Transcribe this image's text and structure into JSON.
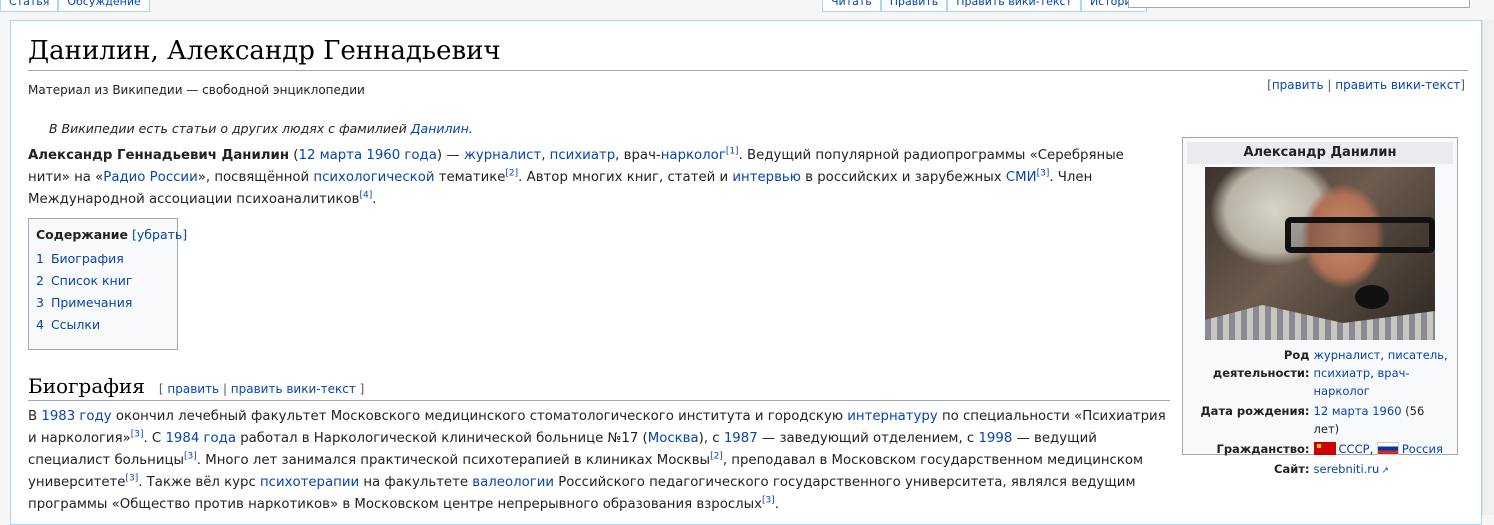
{
  "tabs": {
    "left": [
      "Статья",
      "Обсуждение"
    ],
    "right": [
      "Читать",
      "Править",
      "Править вики-текст",
      "История"
    ]
  },
  "article": {
    "title": "Данилин, Александр Геннадьевич",
    "site_sub": "Материал из Википедии — свободной энциклопедии",
    "edit_link": "править",
    "edit_source_link": "править вики-текст",
    "separator": "|",
    "hatnote_text": "В Википедии есть статьи о других людях с фамилией",
    "hatnote_link": "Данилин",
    "hatnote_end": "."
  },
  "lead": {
    "name": "Александр Геннадьевич Данилин",
    "birth_date": "12 марта 1960 года",
    "dash": " — ",
    "journalist": "журналист",
    "psychiatrist": "психиатр",
    "narco_prefix": "врач-",
    "narcologist": "нарколог",
    "ref1": "[1]",
    "t1": ". Ведущий популярной радиопрограммы «Серебряные нити» на «",
    "radio": "Радио России",
    "t2": "», посвящённой ",
    "psychological": "психологической",
    "t3": " тематике",
    "ref2": "[2]",
    "t4": ". Автор многих книг, статей и ",
    "interviews": "интервью",
    "t5": " в российских и зарубежных ",
    "media": "СМИ",
    "ref3": "[3]",
    "t6": ". Член Международной ассоциации психоаналитиков",
    "ref4": "[4]",
    "t7": "."
  },
  "toc": {
    "title": "Содержание",
    "toggle": "[убрать]",
    "items": [
      {
        "num": "1",
        "label": "Биография"
      },
      {
        "num": "2",
        "label": "Список книг"
      },
      {
        "num": "3",
        "label": "Примечания"
      },
      {
        "num": "4",
        "label": "Ссылки"
      }
    ]
  },
  "bio_section": {
    "heading": "Биография",
    "edit_open": "[ ",
    "edit": "править",
    "edit_source": "править вики-текст",
    "edit_close": " ]"
  },
  "bio": {
    "p1": "В ",
    "year1983": "1983 году",
    "p2": " окончил лечебный факультет Московского медицинского стоматологического института и городскую ",
    "internship": "интернатуру",
    "p3": " по специальности «Психиатрия и наркология»",
    "ref3a": "[3]",
    "p4": ". С ",
    "year1984": "1984 года",
    "p5": " работал в Наркологической клинической больнице №17 (",
    "moscow": "Москва",
    "p6": "), с ",
    "year1987": "1987",
    "p7": " — заведующий отделением, с ",
    "year1998": "1998",
    "p8": " — ведущий специалист больницы",
    "ref3b": "[3]",
    "p9": ". Много лет занимался практической психотерапией в клиниках Москвы",
    "ref2a": "[2]",
    "p10": ", преподавал в Московском государственном медицинском университете",
    "ref3c": "[3]",
    "p11": ". Также вёл курс ",
    "psychotherapy": "психотерапии",
    "p12": " на факультете ",
    "valeology": "валеологии",
    "p13": " Российского педагогического государственного университета, являлся ведущим программы «Общество против наркотиков» в Московском центре непрерывного образования взрослых",
    "ref3d": "[3]",
    "p14": "."
  },
  "infobox": {
    "title": "Александр Данилин",
    "occupation_label": "Род деятельности:",
    "occupation_1": "журналист",
    "occupation_2": "писатель",
    "occupation_3": "психиатр",
    "occupation_4": "врач-нарколог",
    "birth_label": "Дата рождения:",
    "birth_value": "12 марта 1960",
    "age": " (56 лет)",
    "citizenship_label": "Гражданство:",
    "ussr": "СССР",
    "russia": "Россия",
    "site_label": "Сайт:",
    "site_value": "serebniti.ru"
  }
}
